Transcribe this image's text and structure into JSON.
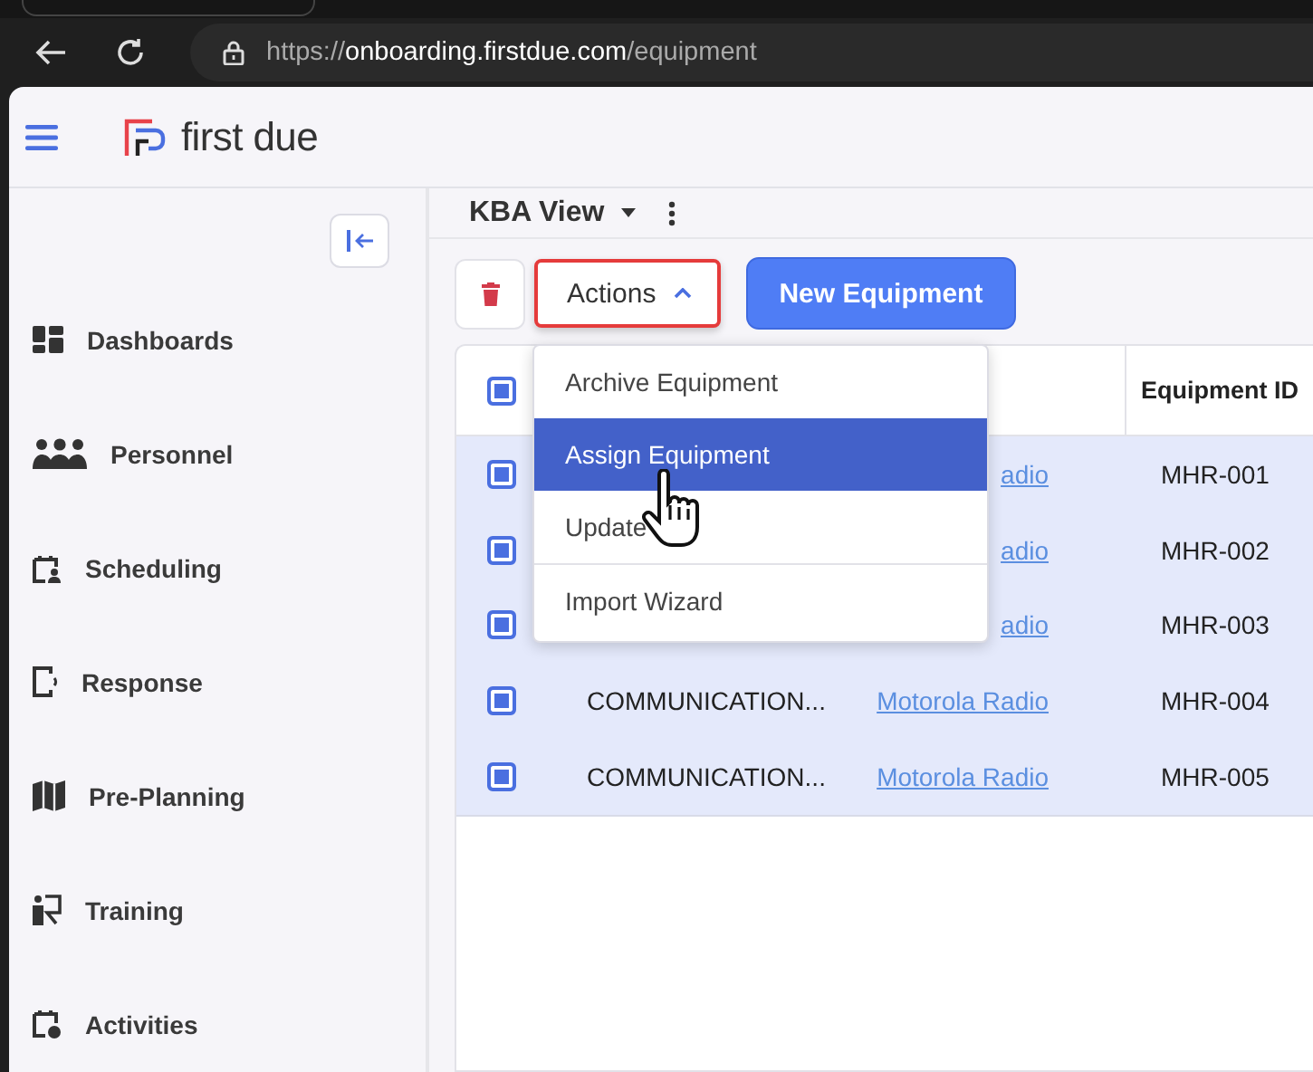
{
  "browser": {
    "url_scheme": "https://",
    "url_host": "onboarding.firstdue.com",
    "url_path": "/equipment"
  },
  "app": {
    "logo_text": "first due"
  },
  "sidebar": {
    "items": [
      {
        "kind": "dashboards",
        "label": "Dashboards"
      },
      {
        "kind": "personnel",
        "label": "Personnel"
      },
      {
        "kind": "scheduling",
        "label": "Scheduling"
      },
      {
        "kind": "response",
        "label": "Response"
      },
      {
        "kind": "preplanning",
        "label": "Pre-Planning"
      },
      {
        "kind": "training",
        "label": "Training"
      },
      {
        "kind": "activities",
        "label": "Activities"
      }
    ]
  },
  "view": {
    "title": "KBA View"
  },
  "toolbar": {
    "actions_label": "Actions",
    "actions_highlighted": true,
    "new_label": "New Equipment"
  },
  "actions_menu": {
    "items": [
      {
        "label": "Archive Equipment",
        "selected": false
      },
      {
        "label": "Assign Equipment",
        "selected": true
      },
      {
        "label": "Update",
        "selected": false
      },
      {
        "label": "Import Wizard",
        "selected": false
      }
    ]
  },
  "table": {
    "header_checked": true,
    "columns": {
      "column_4": "Equipment ID"
    },
    "rows": [
      {
        "checked": true,
        "link": "adio",
        "id": "MHR-001"
      },
      {
        "checked": true,
        "link": "adio",
        "id": "MHR-002"
      },
      {
        "checked": true,
        "link": "adio",
        "id": "MHR-003"
      },
      {
        "checked": true,
        "category": "COMMUNICATION...",
        "link": "Motorola Radio",
        "id": "MHR-004"
      },
      {
        "checked": true,
        "category": "COMMUNICATION...",
        "link": "Motorola Radio",
        "id": "MHR-005"
      }
    ]
  }
}
